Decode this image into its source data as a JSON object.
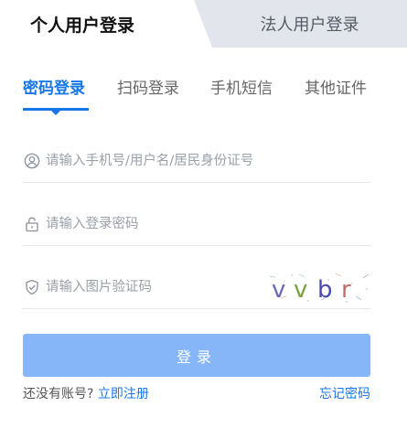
{
  "user_tabs": {
    "personal": "个人用户登录",
    "legal": "法人用户登录"
  },
  "method_tabs": [
    {
      "label": "密码登录",
      "active": true
    },
    {
      "label": "扫码登录",
      "active": false
    },
    {
      "label": "手机短信",
      "active": false
    },
    {
      "label": "其他证件",
      "active": false
    }
  ],
  "form": {
    "username_placeholder": "请输入手机号/用户名/居民身份证号",
    "password_placeholder": "请输入登录密码",
    "captcha_placeholder": "请输入图片验证码",
    "captcha_text": "vvbr",
    "login_label": "登录"
  },
  "footer": {
    "no_account": "还没有账号?",
    "register": "立即注册",
    "forgot": "忘记密码"
  },
  "colors": {
    "accent": "#1677e8",
    "button": "#86b6f7",
    "inactive_tab_bg": "#e2e5ec"
  }
}
